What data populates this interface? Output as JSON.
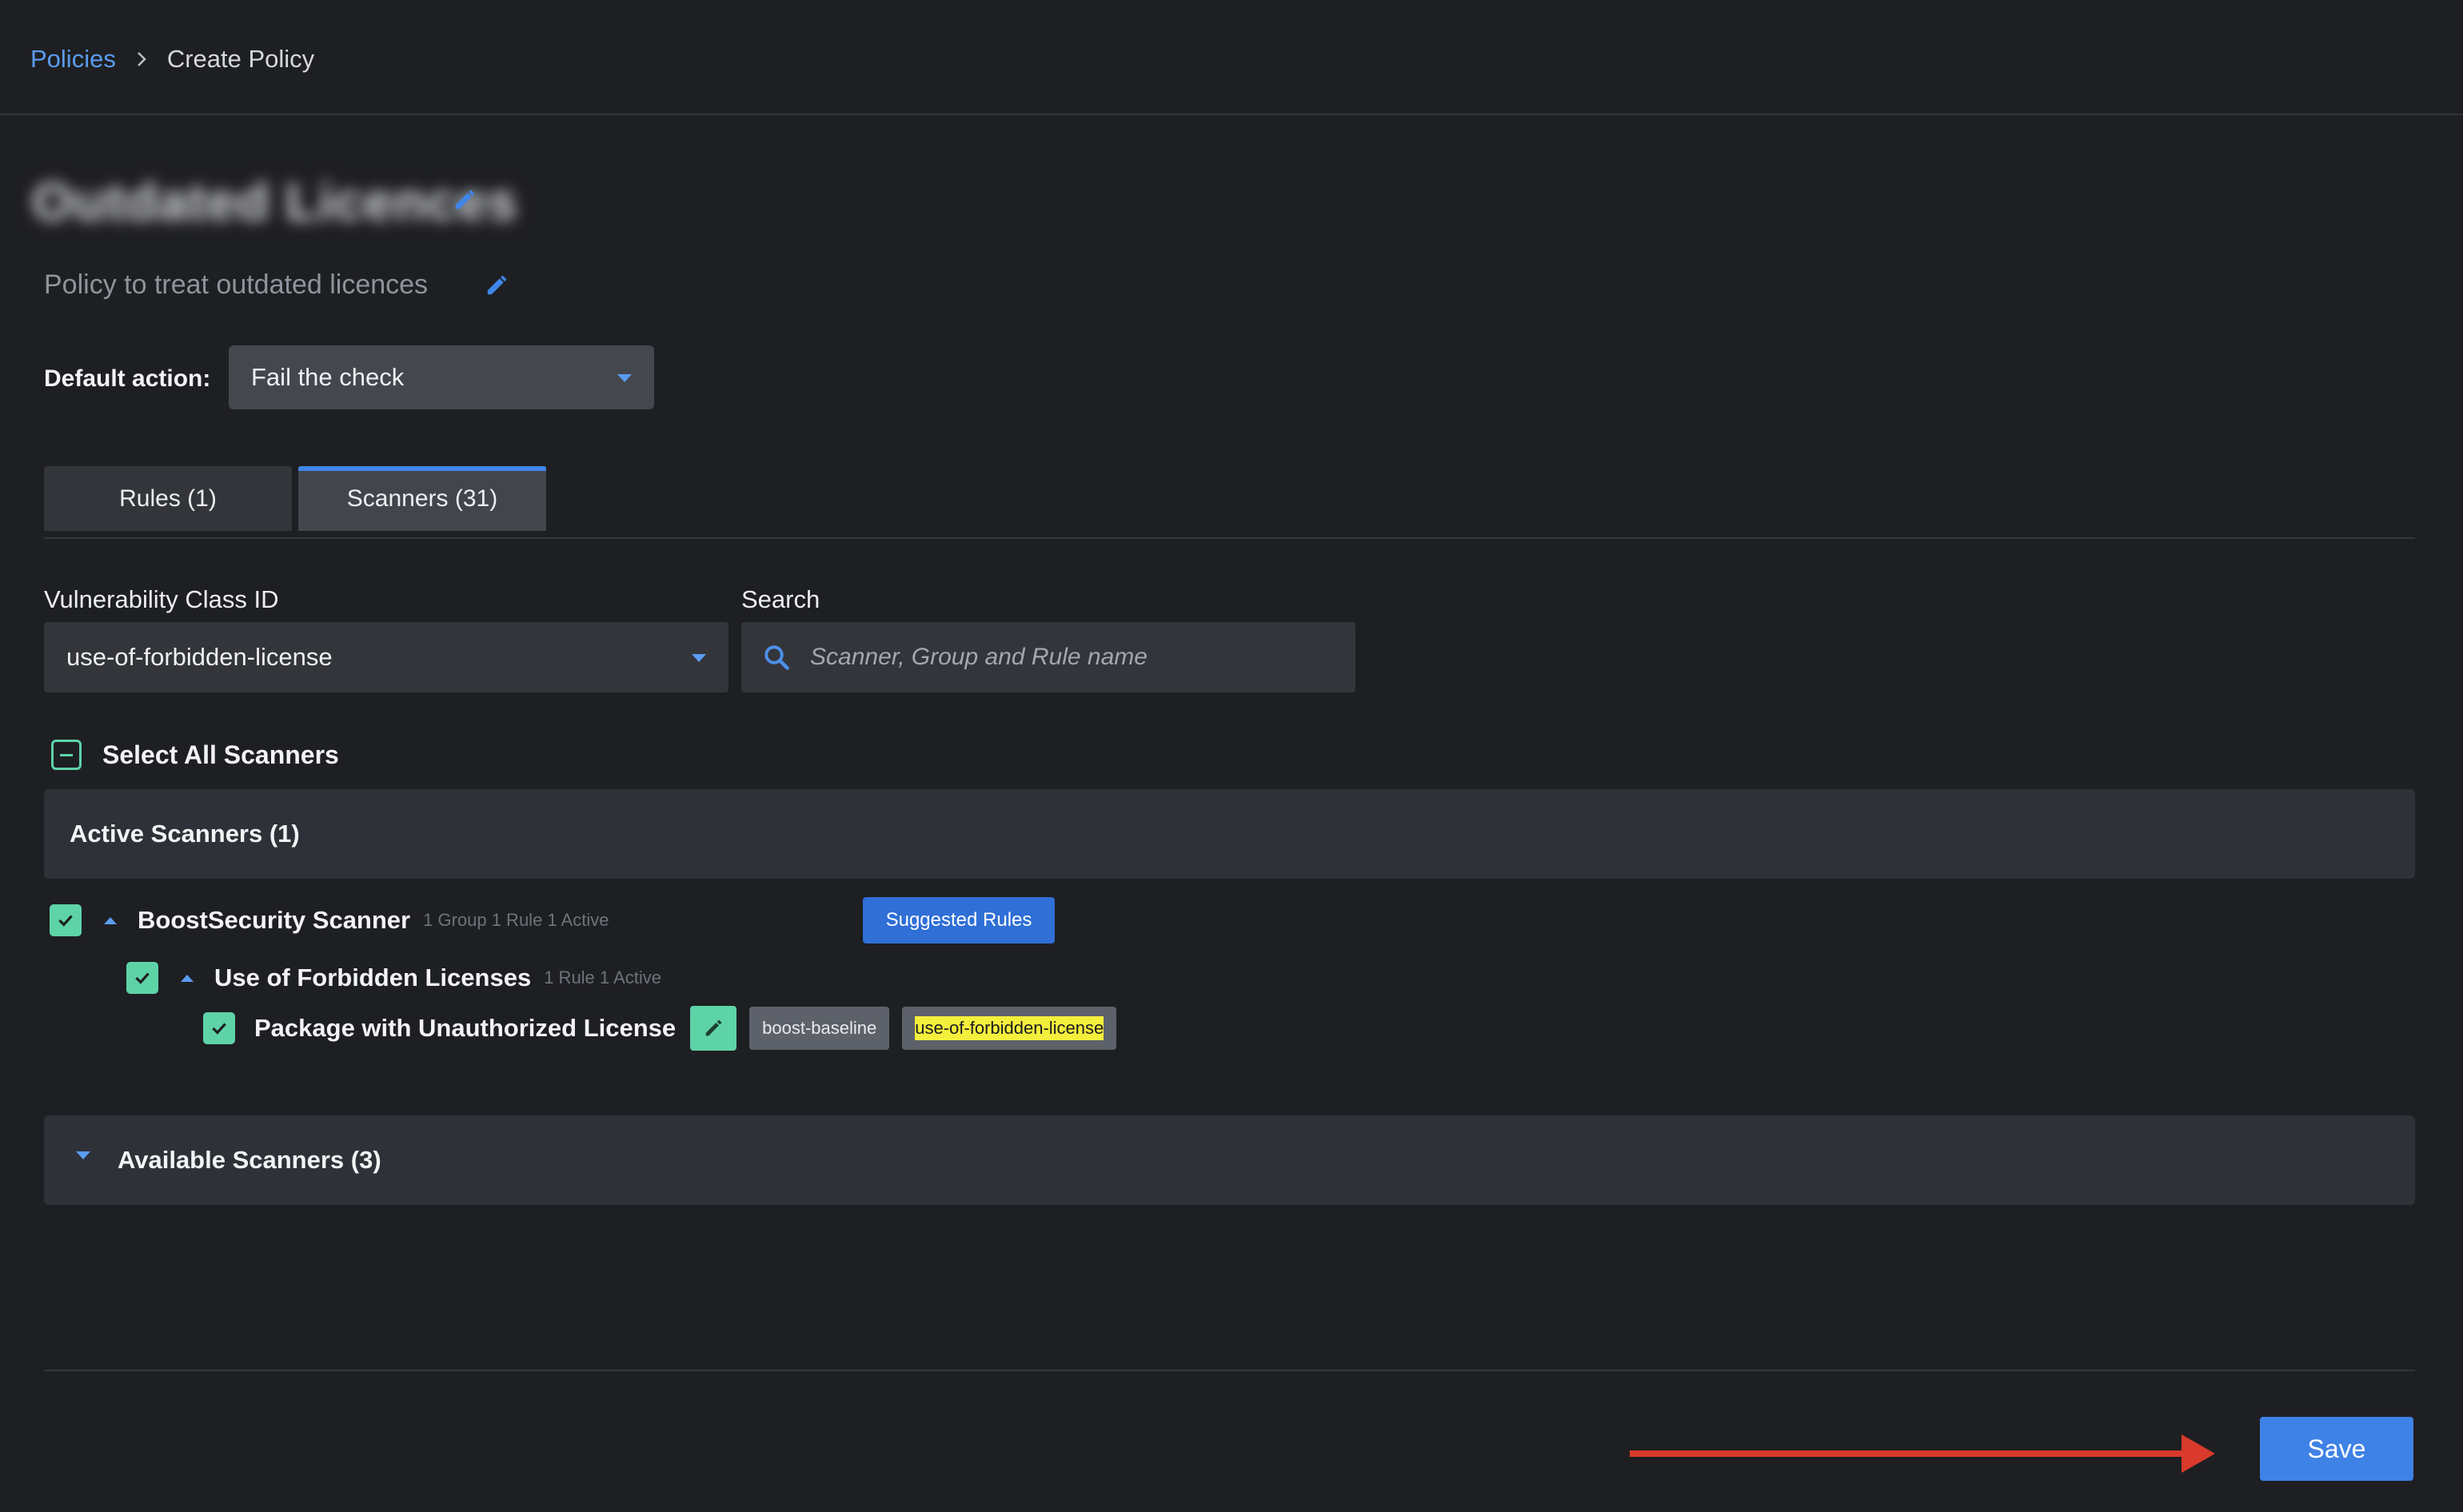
{
  "breadcrumb": {
    "root": "Policies",
    "current": "Create Policy"
  },
  "policy": {
    "name": "Outdated Licences",
    "description": "Policy to treat outdated licences"
  },
  "default_action": {
    "label": "Default action:",
    "value": "Fail the check"
  },
  "tabs": [
    {
      "label": "Rules (1)",
      "active": false
    },
    {
      "label": "Scanners (31)",
      "active": true
    }
  ],
  "filters": {
    "vuln_class_label": "Vulnerability Class ID",
    "vuln_class_value": "use-of-forbidden-license",
    "search_label": "Search",
    "search_placeholder": "Scanner, Group and Rule name"
  },
  "select_all_label": "Select All Scanners",
  "active_scanners": {
    "title": "Active Scanners (1)",
    "scanner": {
      "name": "BoostSecurity Scanner",
      "meta": "1 Group 1 Rule 1 Active",
      "suggested_label": "Suggested Rules",
      "group": {
        "name": "Use of Forbidden Licenses",
        "meta": "1 Rule 1 Active",
        "rule": {
          "name": "Package with Unauthorized License",
          "tags": [
            "boost-baseline",
            "use-of-forbidden-license"
          ]
        }
      }
    }
  },
  "available_scanners": {
    "title": "Available Scanners (3)"
  },
  "save_label": "Save",
  "colors": {
    "background": "#1e1f22",
    "accent": "#3f82e6",
    "check": "#5ed3a8",
    "highlight": "#f4ef3c",
    "annotation_arrow": "#d93a2b"
  }
}
